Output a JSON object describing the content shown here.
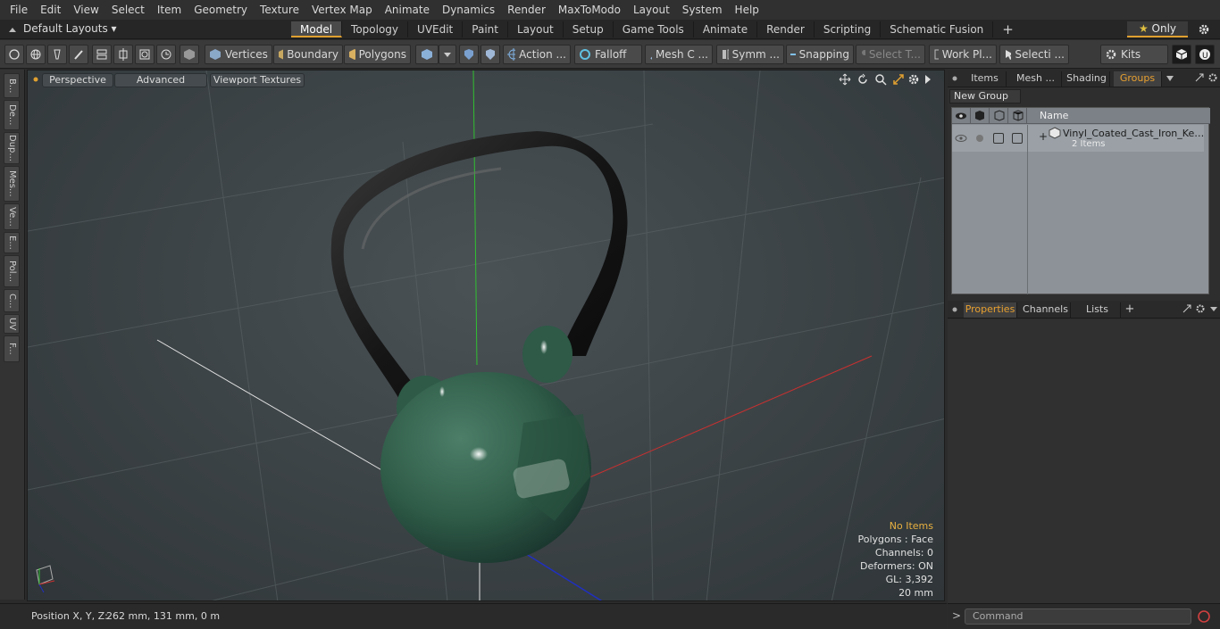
{
  "menu": [
    "File",
    "Edit",
    "View",
    "Select",
    "Item",
    "Geometry",
    "Texture",
    "Vertex Map",
    "Animate",
    "Dynamics",
    "Render",
    "MaxToModo",
    "Layout",
    "System",
    "Help"
  ],
  "layout_selector": "Default Layouts",
  "mode_tabs": [
    "Model",
    "Topology",
    "UVEdit",
    "Paint",
    "Layout",
    "Setup",
    "Game Tools",
    "Animate",
    "Render",
    "Scripting",
    "Schematic Fusion"
  ],
  "active_mode_tab": "Model",
  "only_label": "Only",
  "toolbar": {
    "vertices": "Vertices",
    "boundary": "Boundary",
    "polygons": "Polygons",
    "action": "Action ...",
    "falloff": "Falloff",
    "mesh_c": "Mesh C ...",
    "symm": "Symm ...",
    "snapping": "Snapping",
    "select_t": "Select T...",
    "work_pl": "Work Pl...",
    "selecti": "Selecti ...",
    "kits": "Kits"
  },
  "left_tabs": [
    "B...",
    "De...",
    "Dup...",
    "Mes...",
    "Ve...",
    "E...",
    "Pol...",
    "C...",
    "UV",
    "F..."
  ],
  "viewport": {
    "perspective": "Perspective",
    "advanced": "Advanced",
    "viewport_textures": "Viewport Textures",
    "stats": {
      "no_items": "No Items",
      "polygons": "Polygons : Face",
      "channels": "Channels: 0",
      "deformers": "Deformers: ON",
      "gl": "GL: 3,392",
      "scale": "20 mm"
    }
  },
  "right_panel": {
    "top_tabs": [
      "Items",
      "Mesh ...",
      "Shading",
      "Groups"
    ],
    "active_top_tab": "Groups",
    "new_group": "New Group",
    "name_header": "Name",
    "group_item": {
      "name": "Vinyl_Coated_Cast_Iron_Kett...",
      "sub": "2 Items"
    },
    "bottom_tabs": [
      "Properties",
      "Channels",
      "Lists"
    ],
    "active_bottom_tab": "Properties"
  },
  "statusbar": {
    "position_label": "Position X, Y, Z:",
    "position_value": "262 mm, 131 mm, 0 m"
  },
  "command_placeholder": "Command",
  "colors": {
    "accent": "#e0a030",
    "kettlebell_body": "#2f5c48",
    "handle": "#1b1b1b",
    "axis_x": "#c83030",
    "axis_y": "#30c030",
    "axis_z": "#2030c0"
  }
}
